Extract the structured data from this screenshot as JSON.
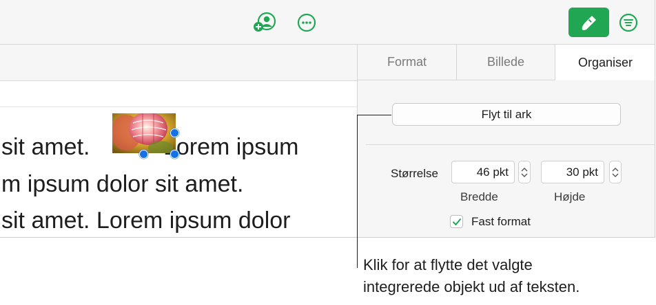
{
  "toolbar": {
    "icons": [
      "add-collaborator-icon",
      "more-options-icon",
      "format-paintbrush-icon",
      "organize-filter-icon"
    ],
    "accent_color": "#21a753"
  },
  "document": {
    "lines": [
      {
        "before_image": "sit amet. ",
        "after_image": "Lorem ipsum"
      },
      {
        "text": "m ipsum dolor sit amet."
      },
      {
        "text": "sit amet. Lorem ipsum dolor"
      }
    ],
    "selection_handle_color": "#1472e6"
  },
  "sidebar": {
    "tabs": [
      {
        "label": "Format",
        "active": false
      },
      {
        "label": "Billede",
        "active": false
      },
      {
        "label": "Organiser",
        "active": true
      }
    ],
    "move_button_label": "Flyt til ark",
    "size": {
      "label": "Størrelse",
      "width_value": "46 pkt",
      "width_label": "Bredde",
      "height_value": "30 pkt",
      "height_label": "Højde"
    },
    "constrain": {
      "label": "Fast format",
      "checked": true
    }
  },
  "callout": {
    "text_line1": "Klik for at flytte det valgte",
    "text_line2": "integrerede objekt ud af teksten."
  }
}
